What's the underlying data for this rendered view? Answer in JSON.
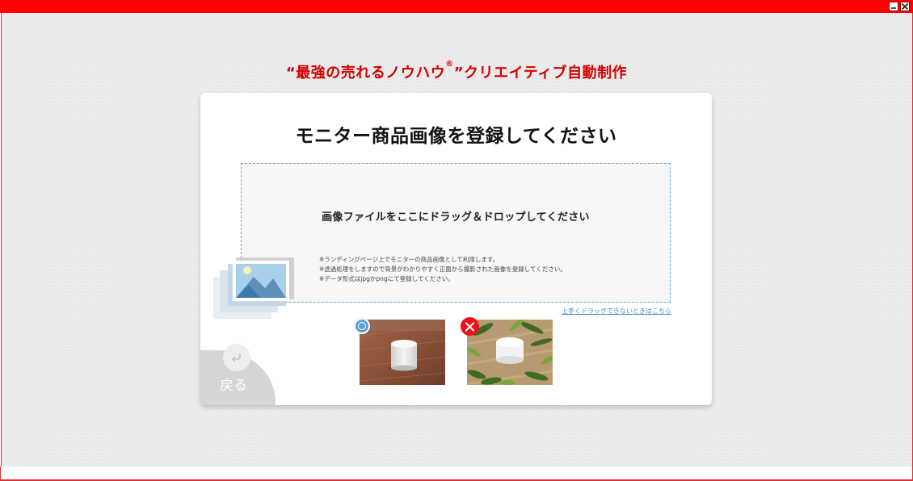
{
  "window": {
    "minimize_icon": "minimize-icon",
    "close_icon": "close-icon",
    "frame_color": "#ff0000"
  },
  "app": {
    "heading_main": "“最強の売れるノウハウ",
    "heading_mark": "®",
    "heading_rest": "”クリエイティブ自動制作",
    "heading_color": "#d40000"
  },
  "card": {
    "title": "モニター商品画像を登録してください",
    "dropzone": {
      "main_text": "画像ファイルをここにドラッグ＆ドロップしてください",
      "notes": [
        "※ランディングページ上でモニターの商品画像として利用します。",
        "※透過処理をしますので背景がわかりやすく正面から撮影された画像を登録してください。",
        "※データ形式はjpgかpngにて登録してください。"
      ],
      "icon": "image-stack-icon"
    },
    "help_link": "上手くドラッグできないときはこちら",
    "thumbnails": [
      {
        "icon": "radio-selected-icon",
        "alt": "speaker-on-wood-photo"
      },
      {
        "icon": "delete-icon",
        "alt": "cream-jar-with-plants-photo"
      }
    ],
    "back": {
      "label": "戻る",
      "icon": "return-arrow-icon"
    },
    "accent_color": "#5d9fd6",
    "delete_color": "#e8141b"
  }
}
